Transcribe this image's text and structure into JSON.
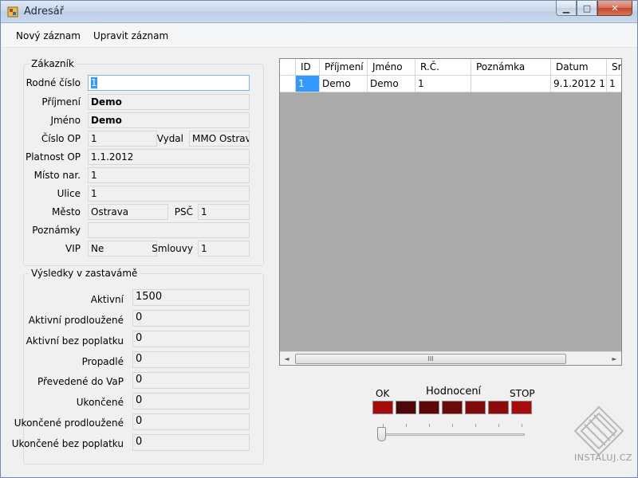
{
  "window": {
    "title": "Adresář",
    "controls": {
      "minimize": "▁",
      "maximize": "□",
      "close": "✕"
    }
  },
  "menu": {
    "items": [
      "Nový záznam",
      "Upravit záznam"
    ]
  },
  "customer": {
    "group_title": "Zákazník",
    "rodne_cislo": {
      "label": "Rodné číslo",
      "value": "1"
    },
    "prijmeni": {
      "label": "Příjmení",
      "value": "Demo"
    },
    "jmeno": {
      "label": "Jméno",
      "value": "Demo"
    },
    "cislo_op": {
      "label": "Číslo OP",
      "value": "1"
    },
    "vydal": {
      "label": "Vydal",
      "value": "MMO Ostrava"
    },
    "platnost_op": {
      "label": "Platnost OP",
      "value": "1.1.2012"
    },
    "misto_nar": {
      "label": "Místo nar.",
      "value": "1"
    },
    "ulice": {
      "label": "Ulice",
      "value": "1"
    },
    "mesto": {
      "label": "Město",
      "value": "Ostrava"
    },
    "psc": {
      "label": "PSČ",
      "value": "1"
    },
    "poznamky": {
      "label": "Poznámky",
      "value": ""
    },
    "vip": {
      "label": "VIP",
      "value": "Ne"
    },
    "smlouvy": {
      "label": "Smlouvy",
      "value": "1"
    }
  },
  "results": {
    "group_title": "Výsledky v zastavámě",
    "rows": [
      {
        "label": "Aktivní",
        "value": "1500"
      },
      {
        "label": "Aktivní prodloužené",
        "value": "0"
      },
      {
        "label": "Aktivní bez poplatku",
        "value": "0"
      },
      {
        "label": "Propadlé",
        "value": "0"
      },
      {
        "label": "Převedené do VaP",
        "value": "0"
      },
      {
        "label": "Ukončené",
        "value": "0"
      },
      {
        "label": "Ukončené prodloužené",
        "value": "0"
      },
      {
        "label": "Ukončené bez poplatku",
        "value": "0"
      }
    ]
  },
  "grid": {
    "columns": [
      "ID",
      "Příjmení",
      "Jméno",
      "R.Č.",
      "Poznámka",
      "Datum",
      "Sm"
    ],
    "rows": [
      {
        "id": "1",
        "prijmeni": "Demo",
        "jmeno": "Demo",
        "rc": "1",
        "poznamka": "",
        "datum": "9.1.2012 1...",
        "sm": "1"
      }
    ],
    "scroll_glyphs": {
      "left": "◄",
      "right": "►",
      "grip": "III"
    }
  },
  "rating": {
    "title": "Hodnocení",
    "ok_label": "OK",
    "stop_label": "STOP",
    "swatch_colors": [
      "#a50b0b",
      "#4f0607",
      "#5c0808",
      "#6c0909",
      "#7e0a0a",
      "#8e0b0b",
      "#a60c0c"
    ],
    "slider_level": 0
  },
  "watermark": {
    "text": "INSTALUJ.CZ"
  }
}
